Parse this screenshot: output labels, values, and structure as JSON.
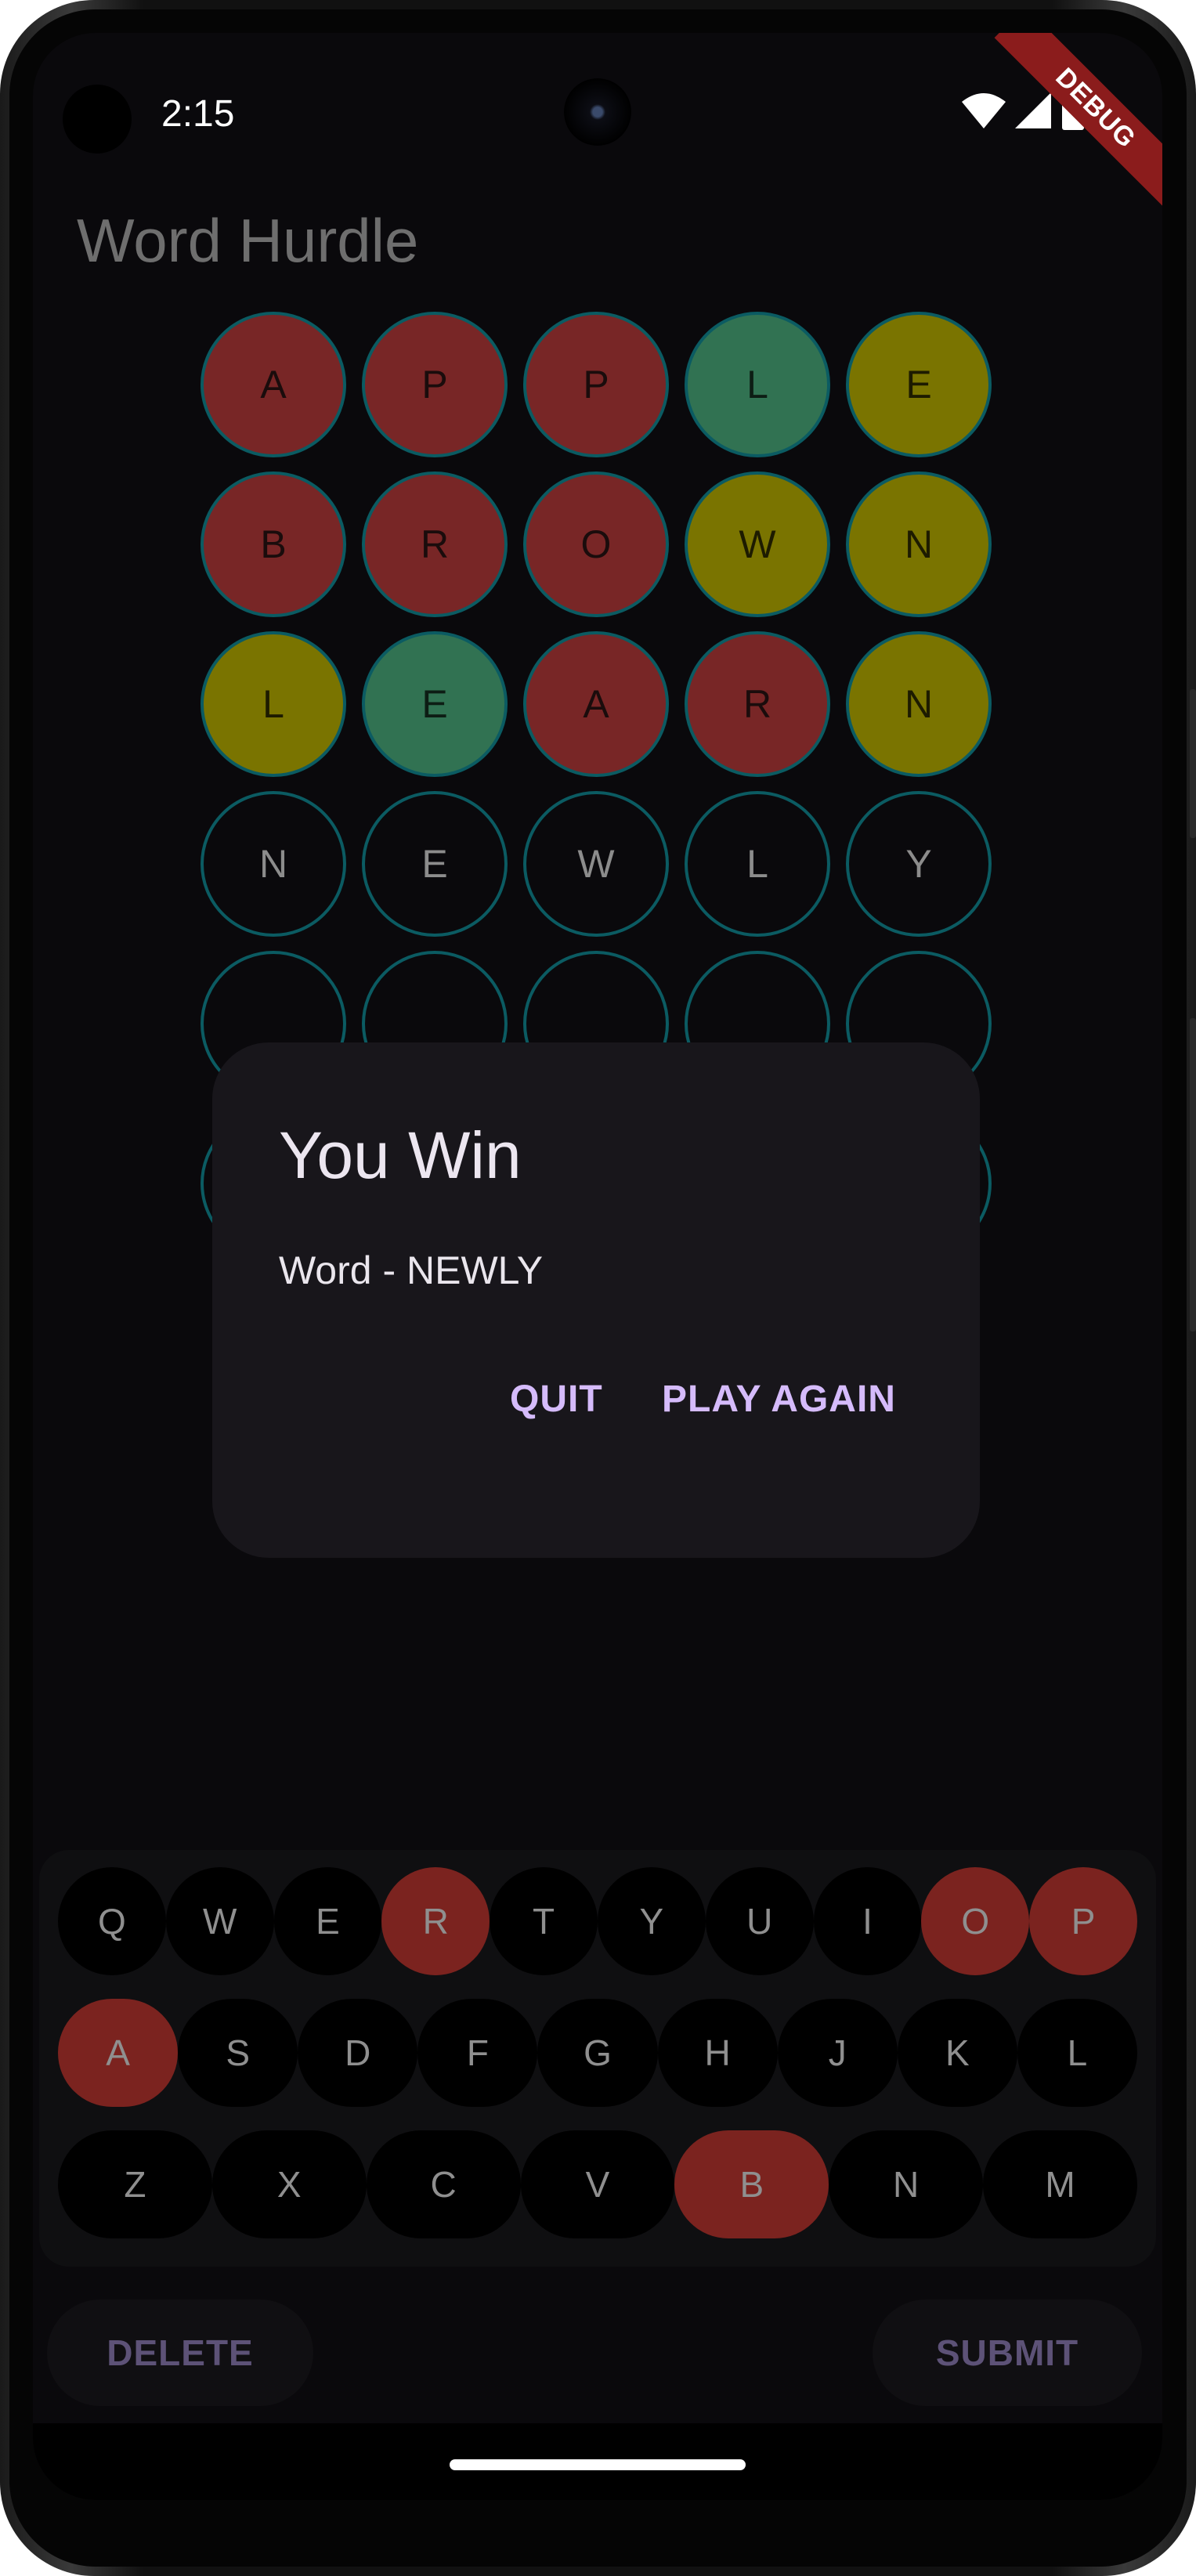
{
  "status_bar": {
    "time": "2:15",
    "icons": [
      "wifi-icon",
      "cellular-signal-icon",
      "battery-icon"
    ],
    "debug_banner": "DEBUG"
  },
  "app_bar": {
    "title": "Word Hurdle"
  },
  "board": {
    "rows": [
      [
        {
          "l": "A",
          "s": "red"
        },
        {
          "l": "P",
          "s": "red"
        },
        {
          "l": "P",
          "s": "red"
        },
        {
          "l": "L",
          "s": "green"
        },
        {
          "l": "E",
          "s": "yellow"
        }
      ],
      [
        {
          "l": "B",
          "s": "red"
        },
        {
          "l": "R",
          "s": "red"
        },
        {
          "l": "O",
          "s": "red"
        },
        {
          "l": "W",
          "s": "yellow"
        },
        {
          "l": "N",
          "s": "yellow"
        }
      ],
      [
        {
          "l": "L",
          "s": "yellow"
        },
        {
          "l": "E",
          "s": "green"
        },
        {
          "l": "A",
          "s": "red"
        },
        {
          "l": "R",
          "s": "red"
        },
        {
          "l": "N",
          "s": "yellow"
        }
      ],
      [
        {
          "l": "N",
          "s": "empty"
        },
        {
          "l": "E",
          "s": "empty"
        },
        {
          "l": "W",
          "s": "empty"
        },
        {
          "l": "L",
          "s": "empty"
        },
        {
          "l": "Y",
          "s": "empty"
        }
      ],
      [
        {
          "l": "",
          "s": "empty"
        },
        {
          "l": "",
          "s": "empty"
        },
        {
          "l": "",
          "s": "empty"
        },
        {
          "l": "",
          "s": "empty"
        },
        {
          "l": "",
          "s": "empty"
        }
      ],
      [
        {
          "l": "",
          "s": "empty"
        },
        {
          "l": "",
          "s": "empty"
        },
        {
          "l": "",
          "s": "empty"
        },
        {
          "l": "",
          "s": "empty"
        },
        {
          "l": "",
          "s": "empty"
        }
      ]
    ],
    "colors": {
      "red": "#782626",
      "green": "#317252",
      "yellow": "#7a7400",
      "outline": "#0b5b62"
    }
  },
  "dialog": {
    "title": "You Win",
    "body": "Word - NEWLY",
    "quit_label": "QUIT",
    "play_again_label": "PLAY AGAIN"
  },
  "keyboard": {
    "rows": [
      [
        {
          "k": "Q"
        },
        {
          "k": "W"
        },
        {
          "k": "E"
        },
        {
          "k": "R",
          "used": true
        },
        {
          "k": "T"
        },
        {
          "k": "Y"
        },
        {
          "k": "U"
        },
        {
          "k": "I"
        },
        {
          "k": "O",
          "used": true
        },
        {
          "k": "P",
          "used": true
        }
      ],
      [
        {
          "k": "A",
          "used": true
        },
        {
          "k": "S"
        },
        {
          "k": "D"
        },
        {
          "k": "F"
        },
        {
          "k": "G"
        },
        {
          "k": "H"
        },
        {
          "k": "J"
        },
        {
          "k": "K"
        },
        {
          "k": "L"
        }
      ],
      [
        {
          "k": "Z"
        },
        {
          "k": "X"
        },
        {
          "k": "C"
        },
        {
          "k": "V"
        },
        {
          "k": "B",
          "used": true
        },
        {
          "k": "N"
        },
        {
          "k": "M"
        }
      ]
    ],
    "used_color": "#7b231f"
  },
  "actions": {
    "delete_label": "DELETE",
    "submit_label": "SUBMIT"
  }
}
